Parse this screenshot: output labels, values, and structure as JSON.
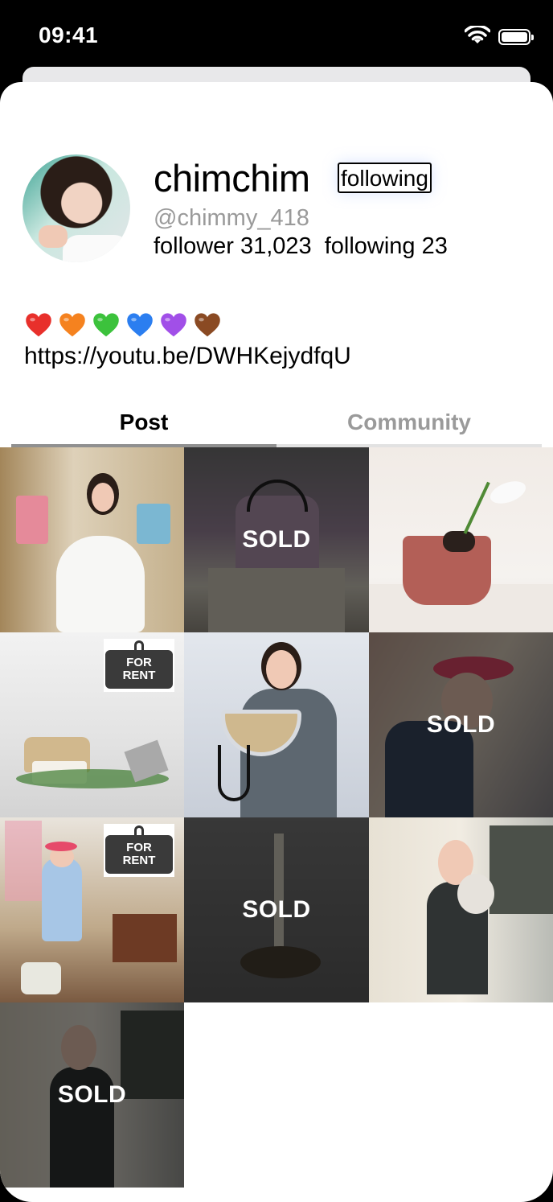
{
  "status_bar": {
    "time": "09:41"
  },
  "profile": {
    "username": "chimchim",
    "follow_button": "following",
    "handle": "@chimmy_418",
    "follower_label": "follower 31,023",
    "following_label": "following 23",
    "hearts": [
      "#e8302b",
      "#f5821f",
      "#3cc23c",
      "#2b7ef0",
      "#a14fe8",
      "#8a4a23"
    ],
    "link": "https://youtu.be/DWHKejydfqU"
  },
  "tabs": [
    {
      "label": "Post",
      "active": true
    },
    {
      "label": "Community",
      "active": false
    }
  ],
  "grid": [
    {
      "badge": ""
    },
    {
      "badge": "SOLD"
    },
    {
      "badge": ""
    },
    {
      "badge": "FOR RENT",
      "rent_line1": "FOR",
      "rent_line2": "RENT"
    },
    {
      "badge": ""
    },
    {
      "badge": "SOLD"
    },
    {
      "badge": "FOR RENT",
      "rent_line1": "FOR",
      "rent_line2": "RENT"
    },
    {
      "badge": "SOLD"
    },
    {
      "badge": ""
    },
    {
      "badge": "SOLD"
    }
  ]
}
